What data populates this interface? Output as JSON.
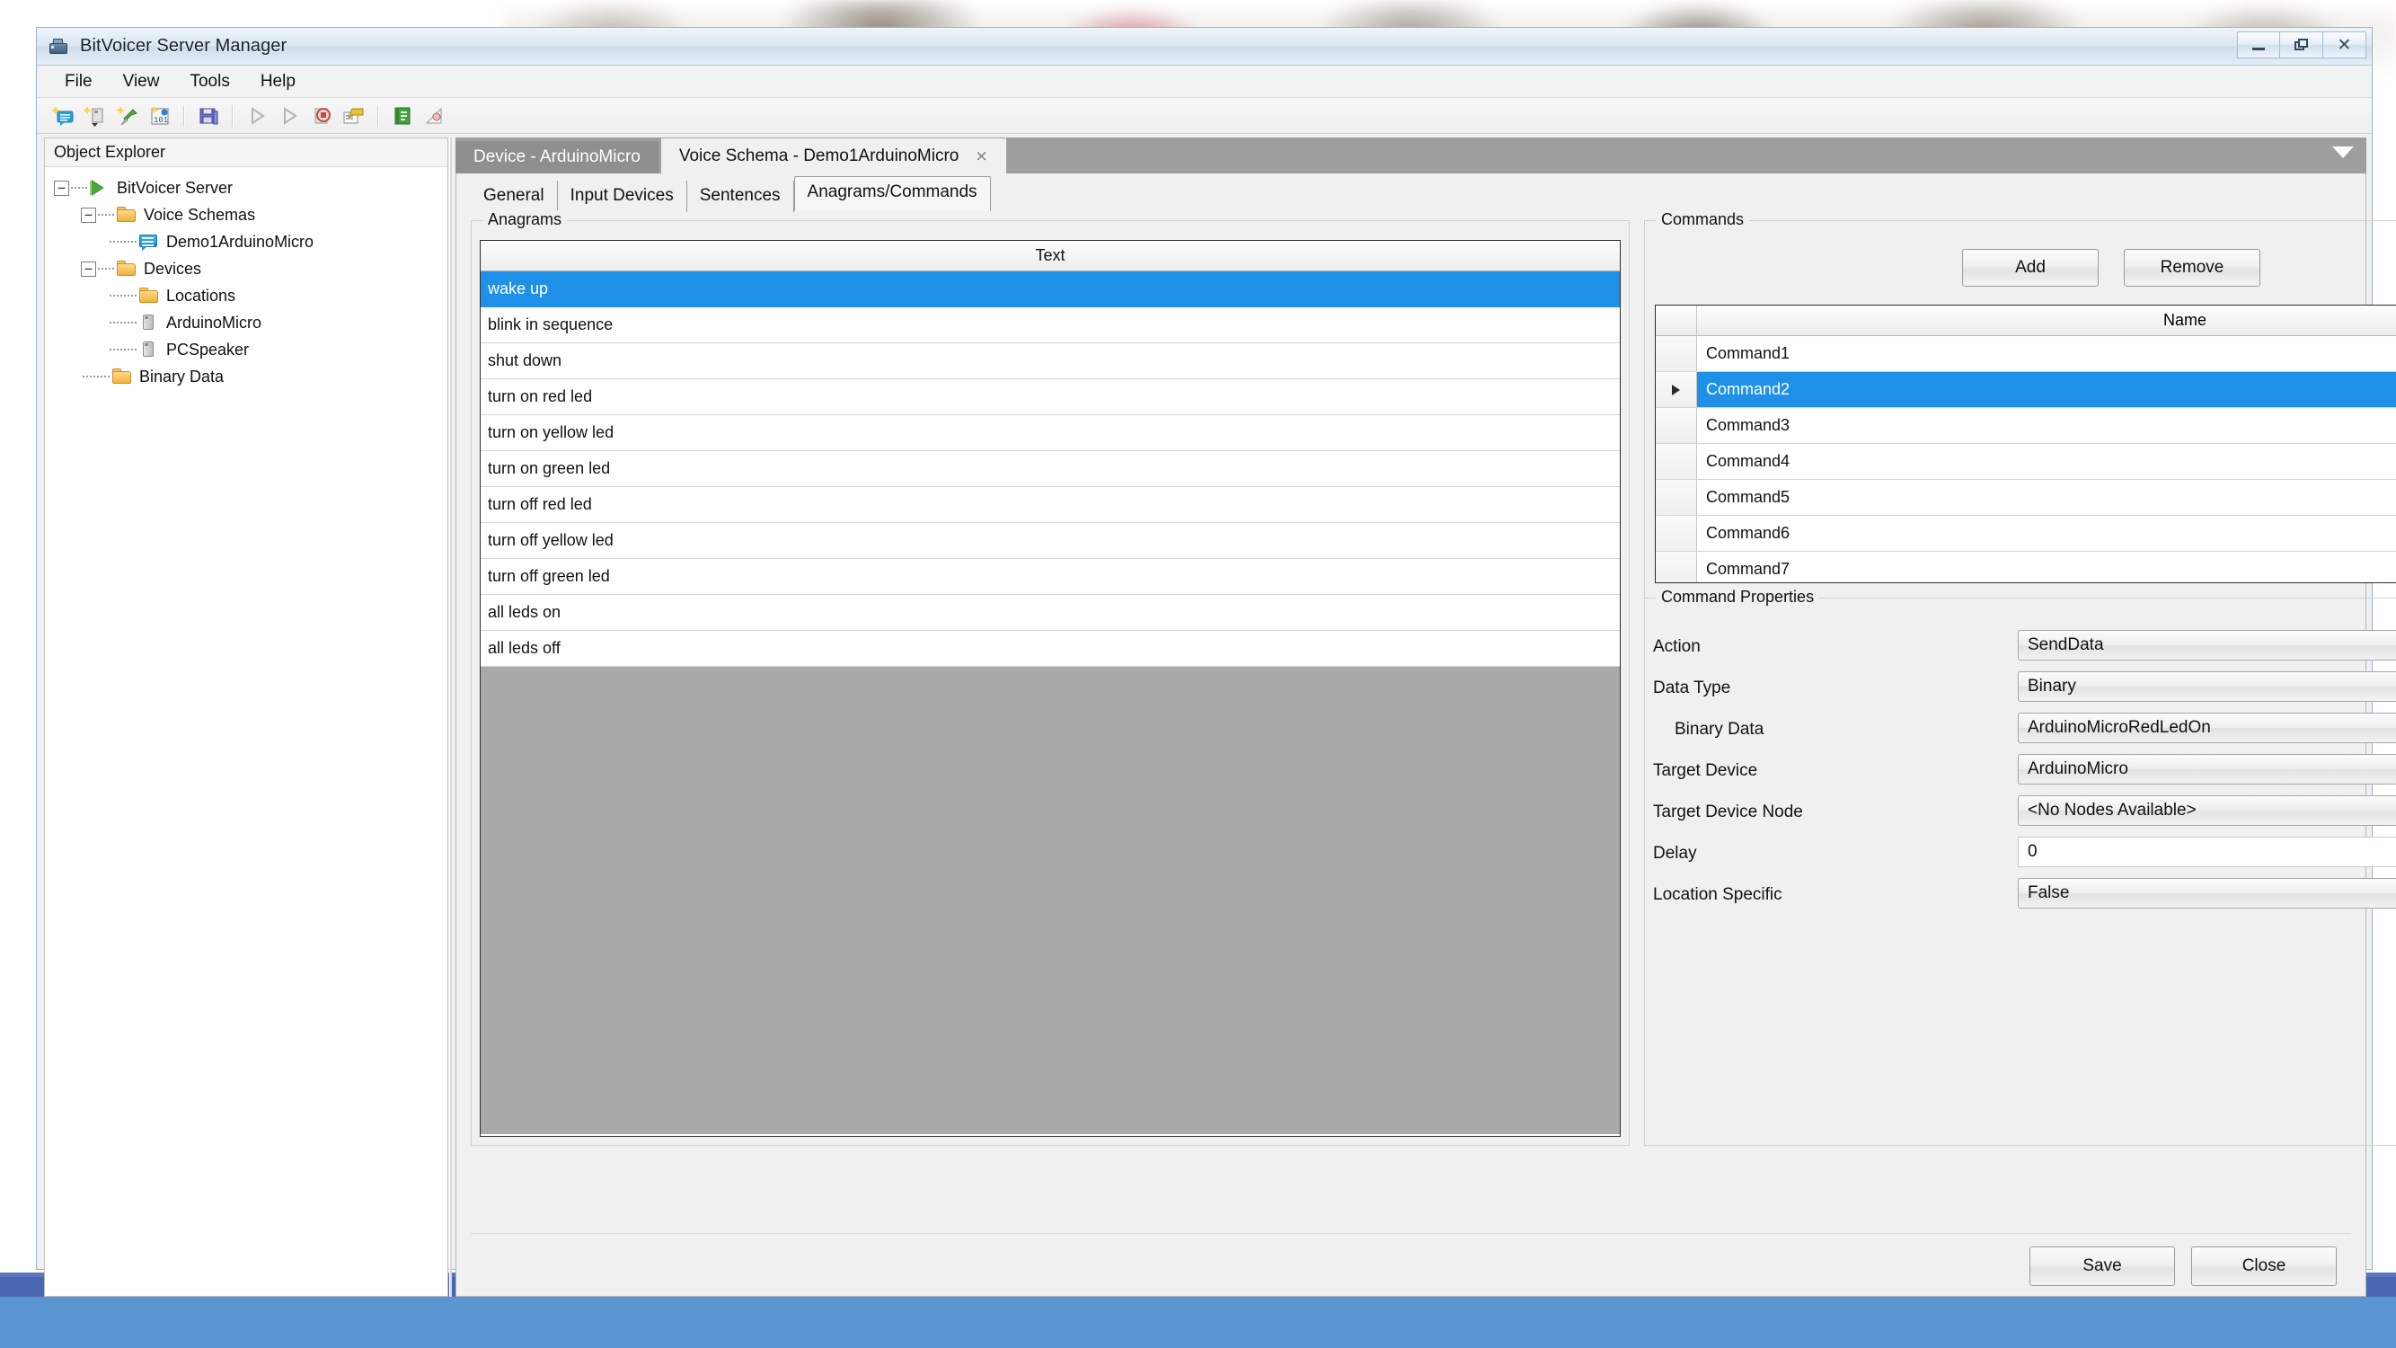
{
  "window": {
    "title": "BitVoicer Server Manager",
    "icon": "app-icon",
    "controls": {
      "minimize": "minimize",
      "restore": "restore",
      "close": "close"
    }
  },
  "menu": {
    "items": [
      "File",
      "View",
      "Tools",
      "Help"
    ]
  },
  "toolbar": {
    "buttons": [
      "new-voice-schema-icon",
      "new-device-icon",
      "new-location-icon",
      "new-binary-data-icon",
      "save-icon",
      "start-icon",
      "play-icon",
      "stop-icon",
      "monitor-icon",
      "log-icon",
      "about-icon"
    ]
  },
  "explorer": {
    "title": "Object Explorer",
    "tree": [
      {
        "label": "BitVoicer Server",
        "icon": "server-icon",
        "level": 0,
        "expander": "-"
      },
      {
        "label": "Voice Schemas",
        "icon": "folder-icon",
        "level": 1,
        "expander": "-"
      },
      {
        "label": "Demo1ArduinoMicro",
        "icon": "voice-schema-icon",
        "level": 2,
        "expander": ""
      },
      {
        "label": "Devices",
        "icon": "folder-icon",
        "level": 1,
        "expander": "-"
      },
      {
        "label": "Locations",
        "icon": "folder-icon",
        "level": 2,
        "expander": ""
      },
      {
        "label": "ArduinoMicro",
        "icon": "device-icon",
        "level": 2,
        "expander": ""
      },
      {
        "label": "PCSpeaker",
        "icon": "device-icon",
        "level": 2,
        "expander": ""
      },
      {
        "label": "Binary Data",
        "icon": "folder-icon",
        "level": 1,
        "expander": ""
      }
    ]
  },
  "document_tabs": {
    "items": [
      {
        "label": "Device - ArduinoMicro",
        "active": false,
        "closable": false
      },
      {
        "label": "Voice Schema - Demo1ArduinoMicro",
        "active": true,
        "closable": true
      }
    ],
    "close_glyph": "×",
    "overflow_icon": "chevron-down-icon"
  },
  "inner_tabs": {
    "items": [
      "General",
      "Input Devices",
      "Sentences",
      "Anagrams/Commands"
    ],
    "selected": "Anagrams/Commands"
  },
  "anagrams": {
    "group_label": "Anagrams",
    "column_header": "Text",
    "selected_index": 0,
    "rows": [
      "wake up",
      "blink in sequence",
      "shut down",
      "turn on red led",
      "turn on yellow led",
      "turn on green led",
      "turn off red led",
      "turn off yellow led",
      "turn off green led",
      "all leds on",
      "all leds off"
    ]
  },
  "commands": {
    "group_label": "Commands",
    "add_label": "Add",
    "remove_label": "Remove",
    "column_header": "Name",
    "selected_index": 1,
    "rows": [
      "Command1",
      "Command2",
      "Command3",
      "Command4",
      "Command5",
      "Command6",
      "Command7"
    ],
    "move_up_icon": "arrow-up-icon",
    "move_down_icon": "arrow-down-icon",
    "move_up_glyph": "⇧",
    "move_down_glyph": "⇩"
  },
  "command_properties": {
    "group_label": "Command Properties",
    "fields": [
      {
        "label": "Action",
        "value": "SendData",
        "control": "combo",
        "refresh": false
      },
      {
        "label": "Data Type",
        "value": "Binary",
        "control": "combo",
        "refresh": false
      },
      {
        "label": "Binary Data",
        "value": "ArduinoMicroRedLedOn",
        "control": "combo",
        "refresh": true,
        "indent": true
      },
      {
        "label": "Target Device",
        "value": "ArduinoMicro",
        "control": "combo",
        "refresh": true
      },
      {
        "label": "Target Device Node",
        "value": "<No Nodes Available>",
        "control": "combo",
        "refresh": false
      },
      {
        "label": "Delay",
        "value": "0",
        "control": "text",
        "refresh": false
      },
      {
        "label": "Location Specific",
        "value": "False",
        "control": "combo",
        "refresh": false
      }
    ],
    "refresh_glyph": "↻"
  },
  "footer": {
    "save_label": "Save",
    "close_label": "Close"
  },
  "colors": {
    "selection_blue": "#1e90e8",
    "grid_empty_gray": "#a9a9a9",
    "tabstrip_gray": "#9e9e9e",
    "window_chrome": "#f0f0f0",
    "desktop_band_dark": "#4a66b0",
    "desktop_band_light": "#5b95d1"
  }
}
